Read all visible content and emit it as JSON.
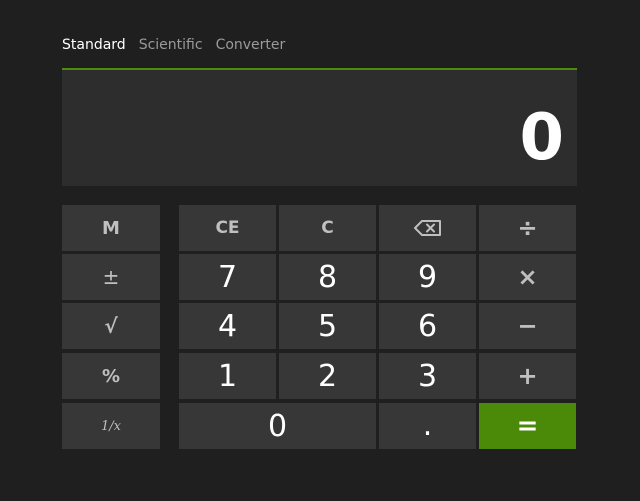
{
  "tabs": [
    {
      "label": "Standard",
      "active": true
    },
    {
      "label": "Scientific",
      "active": false
    },
    {
      "label": "Converter",
      "active": false
    }
  ],
  "display": {
    "value": "0"
  },
  "memory": {
    "m": "M",
    "plus_minus": "±",
    "sqrt": "√",
    "percent": "%",
    "reciprocal": "1/x"
  },
  "keypad": {
    "ce": "CE",
    "c": "C",
    "backspace_icon": "backspace-icon",
    "divide": "÷",
    "multiply": "×",
    "minus": "−",
    "plus": "+",
    "equals": "=",
    "decimal": ".",
    "digits": {
      "d0": "0",
      "d1": "1",
      "d2": "2",
      "d3": "3",
      "d4": "4",
      "d5": "5",
      "d6": "6",
      "d7": "7",
      "d8": "8",
      "d9": "9"
    }
  },
  "colors": {
    "background": "#1f1f1f",
    "button": "#373737",
    "display": "#2d2d2d",
    "accent": "#4b8a08"
  }
}
